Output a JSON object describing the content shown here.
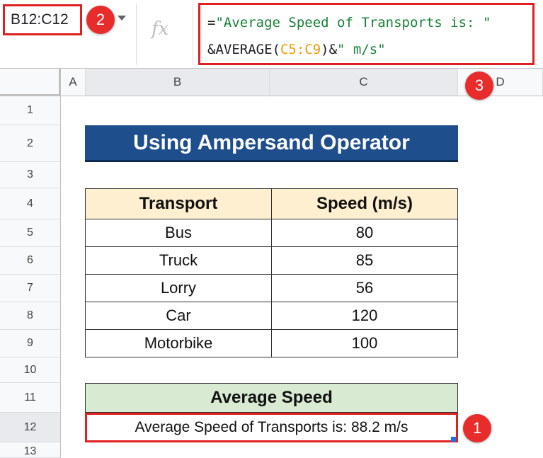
{
  "name_box": "B12:C12",
  "fx_label": "fx",
  "formula": {
    "line1_op": "=",
    "line1_str": "\"Average Speed of Transports is: \"",
    "line2_op_a": "&AVERAGE(",
    "line2_ref": "C5:C9",
    "line2_op_b": ")&",
    "line2_str": "\" m/s\""
  },
  "badges": {
    "one": "1",
    "two": "2",
    "three": "3"
  },
  "columns": [
    "A",
    "B",
    "C",
    "D"
  ],
  "rows": [
    "1",
    "2",
    "3",
    "4",
    "5",
    "6",
    "7",
    "8",
    "9",
    "10",
    "11",
    "12",
    "13"
  ],
  "title": "Using Ampersand Operator",
  "table": {
    "headers": [
      "Transport",
      "Speed (m/s)"
    ],
    "rows": [
      [
        "Bus",
        "80"
      ],
      [
        "Truck",
        "85"
      ],
      [
        "Lorry",
        "56"
      ],
      [
        "Car",
        "120"
      ],
      [
        "Motorbike",
        "100"
      ]
    ]
  },
  "average": {
    "header": "Average Speed",
    "result": "Average Speed of Transports is: 88.2 m/s"
  },
  "colors": {
    "title_bg": "#1f4e8c",
    "header_bg": "#fdefcf",
    "avg_bg": "#d9ead3",
    "highlight": "#e02020"
  }
}
